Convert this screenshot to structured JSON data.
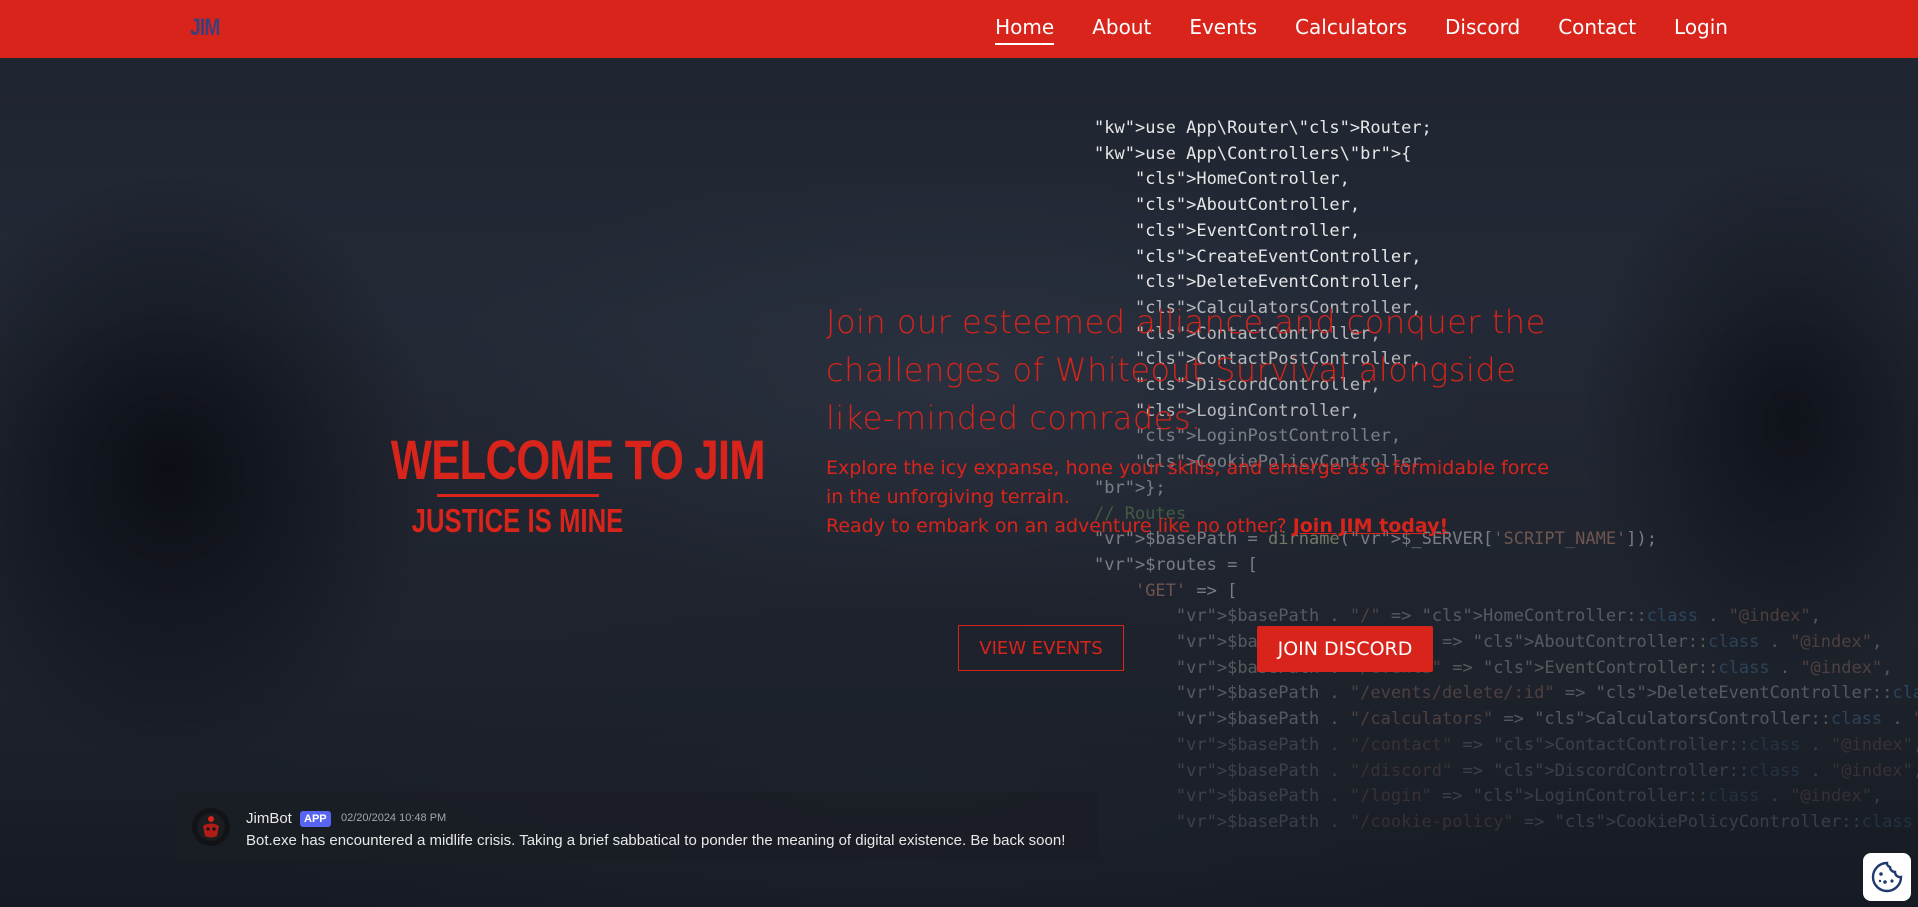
{
  "nav": {
    "logo": "JIM",
    "links": [
      "Home",
      "About",
      "Events",
      "Calculators",
      "Discord",
      "Contact",
      "Login"
    ],
    "active": "Home"
  },
  "code_lines": [
    "use App\\Router\\Router;",
    "use App\\Controllers\\{",
    "    HomeController,",
    "    AboutController,",
    "    EventController,",
    "    CreateEventController,",
    "    DeleteEventController,",
    "    CalculatorsController,",
    "    ContactController,",
    "    ContactPostController,",
    "    DiscordController,",
    "    LoginController,",
    "    LoginPostController,",
    "    CookiePolicyController",
    "};",
    "// Routes",
    "$basePath = dirname($_SERVER['SCRIPT_NAME']);",
    "$routes = [",
    "    'GET' => [",
    "        $basePath . \"/\" => HomeController::class . \"@index\",",
    "        $basePath . \"/about\" => AboutController::class . \"@index\",",
    "        $basePath . \"/events\" => EventController::class . \"@index\",",
    "        $basePath . \"/events/delete/:id\" => DeleteEventController::class . \"@index\",",
    "        $basePath . \"/calculators\" => CalculatorsController::class . \"@index\",",
    "        $basePath . \"/contact\" => ContactController::class . \"@index\",",
    "        $basePath . \"/discord\" => DiscordController::class . \"@index\",",
    "        $basePath . \"/login\" => LoginController::class . \"@index\",",
    "        $basePath . \"/cookie-policy\" => CookiePolicyController::class . \"@index\","
  ],
  "welcome": {
    "title": "WELCOME TO JIM",
    "subtitle": "JUSTICE IS MINE"
  },
  "hero": {
    "heading": "Join our esteemed alliance and conquer the challenges of Whiteout Survival alongside like-minded comrades.",
    "paragraph": "Explore the icy expanse, hone your skills, and emerge as a formidable force in the unforgiving terrain.",
    "cta_prefix": "Ready to embark on an adventure like no other? ",
    "cta_link": "Join JIM today!"
  },
  "buttons": {
    "view_events": "VIEW EVENTS",
    "join_discord": "JOIN DISCORD"
  },
  "bot": {
    "name": "JimBot",
    "badge": "APP",
    "timestamp": "02/20/2024 10:48 PM",
    "message": "Bot.exe has encountered a midlife crisis. Taking a brief sabbatical to ponder the meaning of digital existence. Be back soon!"
  },
  "colors": {
    "brand_red": "#d9241b",
    "nav_logo": "#3b3f7a",
    "discord_badge": "#5865f2"
  },
  "icons": {
    "bot_avatar": "bot-avatar-icon",
    "cookie": "cookie-icon"
  }
}
